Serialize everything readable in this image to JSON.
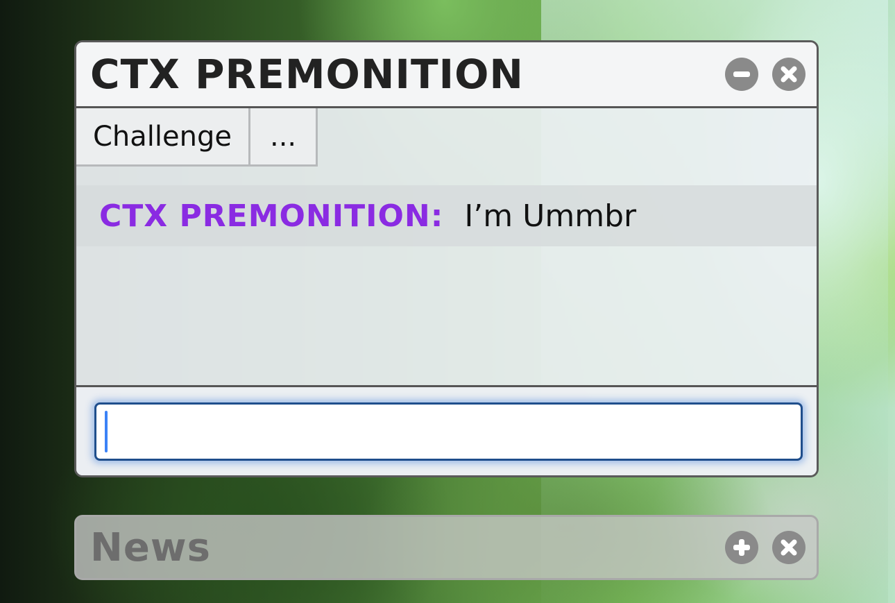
{
  "chat_window": {
    "title": "CTX PREMONITION",
    "minimize_icon": "minus-circle-icon",
    "close_icon": "x-circle-icon",
    "tabs": [
      {
        "label": "Challenge"
      },
      {
        "label": "..."
      }
    ],
    "messages": [
      {
        "author": "CTX PREMONITION:",
        "text": "I’m Ummbr",
        "author_color": "#8a2be2"
      }
    ],
    "input": {
      "value": "",
      "placeholder": ""
    }
  },
  "news_window": {
    "title": "News",
    "expand_icon": "plus-circle-icon",
    "close_icon": "x-circle-icon"
  },
  "colors": {
    "author": "#8a2be2",
    "input_focus": "#1f4e8c",
    "button_gray": "#8a8a8a"
  }
}
